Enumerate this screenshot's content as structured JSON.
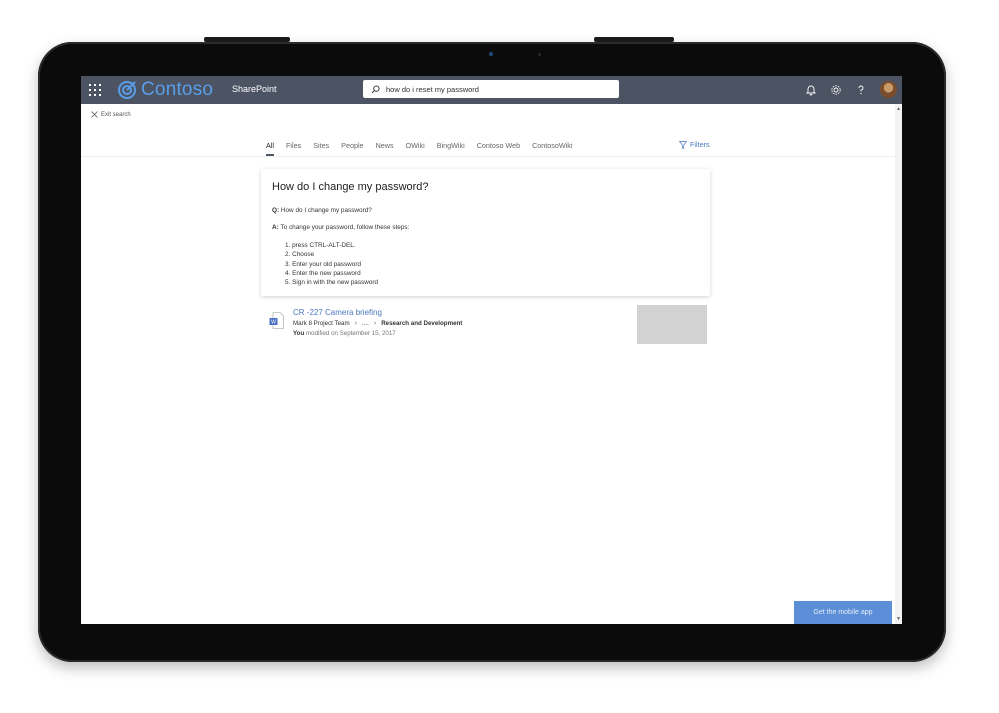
{
  "app": {
    "brand_name": "Contoso",
    "app_name": "SharePoint"
  },
  "search": {
    "query": "how do i reset my password"
  },
  "nav": {
    "exit_label": "Exit search",
    "tabs": [
      {
        "label": "All",
        "active": true
      },
      {
        "label": "Files"
      },
      {
        "label": "Sites"
      },
      {
        "label": "People"
      },
      {
        "label": "News"
      },
      {
        "label": "OWiki"
      },
      {
        "label": "BingWiki"
      },
      {
        "label": "Contoso Web"
      },
      {
        "label": "ContosoWiki"
      }
    ],
    "filters_label": "Filters"
  },
  "answer": {
    "title": "How do I change my password?",
    "q_label": "Q:",
    "question": "How do I change my password?",
    "a_label": "A:",
    "answer_intro": "To change your password, follow these steps:",
    "steps": [
      "1. press CTRL-ALT-DEL.",
      "2. Choose",
      "3. Enter your old password",
      "4. Enter the new password",
      "5. Sign in with the new password"
    ]
  },
  "result": {
    "title": "CR -227 Camera briefing",
    "path": [
      "Mark 8 Project Team",
      "....",
      "Research and Development"
    ],
    "modified_by": "You",
    "modified_text": "modified on September 15, 2017"
  },
  "footer": {
    "mobile_app_label": "Get the mobile app"
  },
  "icons": {
    "waffle": "waffle-icon",
    "logo": "contoso-logo-icon",
    "search": "search-icon",
    "bell": "bell-icon",
    "gear": "gear-icon",
    "help": "help-icon",
    "close": "close-icon",
    "filter": "filter-icon",
    "word": "word-document-icon",
    "chevron": "chevron-right-icon"
  },
  "colors": {
    "suitebar": "#4c5363",
    "brand": "#5a9de8",
    "link": "#4a78c2",
    "mobile_button": "#5b8ed6"
  }
}
